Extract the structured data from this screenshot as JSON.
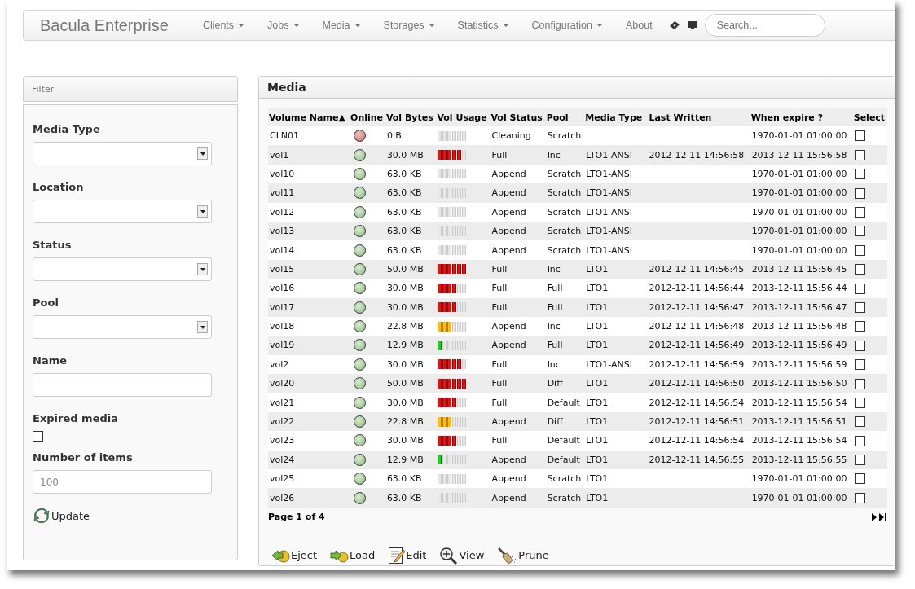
{
  "navbar": {
    "brand": "Bacula Enterprise",
    "menus": [
      {
        "label": "Clients",
        "dropdown": true
      },
      {
        "label": "Jobs",
        "dropdown": true
      },
      {
        "label": "Media",
        "dropdown": true
      },
      {
        "label": "Storages",
        "dropdown": true
      },
      {
        "label": "Statistics",
        "dropdown": true
      },
      {
        "label": "Configuration",
        "dropdown": true
      },
      {
        "label": "About",
        "dropdown": false
      }
    ],
    "search": {
      "placeholder": "Search..."
    }
  },
  "filter": {
    "title": "Filter",
    "fields": [
      {
        "kind": "select",
        "label": "Media Type"
      },
      {
        "kind": "select",
        "label": "Location"
      },
      {
        "kind": "select",
        "label": "Status"
      },
      {
        "kind": "select",
        "label": "Pool"
      },
      {
        "kind": "text",
        "label": "Name"
      },
      {
        "kind": "checkbox",
        "label": "Expired media",
        "checked": false
      },
      {
        "kind": "text",
        "label": "Number of items",
        "value": "100"
      }
    ],
    "update_button": "Update"
  },
  "media": {
    "title": "Media",
    "columns": [
      "Volume Name",
      "Online",
      "Vol Bytes",
      "Vol Usage",
      "Vol Status",
      "Pool",
      "Media Type",
      "Last Written",
      "When expire ?",
      "Select"
    ],
    "sort_marker": "▲",
    "rows": [
      {
        "name": "CLN01",
        "online": false,
        "bytes": "0 B",
        "level": 0,
        "status": "Cleaning",
        "pool": "Scratch",
        "media_type": "",
        "last_written": "",
        "expire": "1970-01-01 01:00:00",
        "selected": false
      },
      {
        "name": "vol1",
        "online": true,
        "bytes": "30.0 MB",
        "level": 0.83,
        "status": "Full",
        "pool": "Inc",
        "media_type": "LTO1-ANSI",
        "last_written": "2012-12-11 14:56:58",
        "expire": "2013-12-11 15:56:58",
        "selected": false
      },
      {
        "name": "vol10",
        "online": true,
        "bytes": "63.0 KB",
        "level": 0,
        "status": "Append",
        "pool": "Scratch",
        "media_type": "LTO1-ANSI",
        "last_written": "",
        "expire": "1970-01-01 01:00:00",
        "selected": false
      },
      {
        "name": "vol11",
        "online": true,
        "bytes": "63.0 KB",
        "level": 0,
        "status": "Append",
        "pool": "Scratch",
        "media_type": "LTO1-ANSI",
        "last_written": "",
        "expire": "1970-01-01 01:00:00",
        "selected": false
      },
      {
        "name": "vol12",
        "online": true,
        "bytes": "63.0 KB",
        "level": 0,
        "status": "Append",
        "pool": "Scratch",
        "media_type": "LTO1-ANSI",
        "last_written": "",
        "expire": "1970-01-01 01:00:00",
        "selected": false
      },
      {
        "name": "vol13",
        "online": true,
        "bytes": "63.0 KB",
        "level": 0,
        "status": "Append",
        "pool": "Scratch",
        "media_type": "LTO1-ANSI",
        "last_written": "",
        "expire": "1970-01-01 01:00:00",
        "selected": false
      },
      {
        "name": "vol14",
        "online": true,
        "bytes": "63.0 KB",
        "level": 0,
        "status": "Append",
        "pool": "Scratch",
        "media_type": "LTO1-ANSI",
        "last_written": "",
        "expire": "1970-01-01 01:00:00",
        "selected": false
      },
      {
        "name": "vol15",
        "online": true,
        "bytes": "50.0 MB",
        "level": 1,
        "status": "Full",
        "pool": "Inc",
        "media_type": "LTO1",
        "last_written": "2012-12-11 14:56:45",
        "expire": "2013-12-11 15:56:45",
        "selected": false
      },
      {
        "name": "vol16",
        "online": true,
        "bytes": "30.0 MB",
        "level": 0.67,
        "status": "Full",
        "pool": "Full",
        "media_type": "LTO1",
        "last_written": "2012-12-11 14:56:44",
        "expire": "2013-12-11 15:56:44",
        "selected": false
      },
      {
        "name": "vol17",
        "online": true,
        "bytes": "30.0 MB",
        "level": 0.67,
        "status": "Full",
        "pool": "Full",
        "media_type": "LTO1",
        "last_written": "2012-12-11 14:56:47",
        "expire": "2013-12-11 15:56:47",
        "selected": false
      },
      {
        "name": "vol18",
        "online": true,
        "bytes": "22.8 MB",
        "level": 0.5,
        "status": "Append",
        "pool": "Inc",
        "media_type": "LTO1",
        "last_written": "2012-12-11 14:56:48",
        "expire": "2013-12-11 15:56:48",
        "selected": false
      },
      {
        "name": "vol19",
        "online": true,
        "bytes": "12.9 MB",
        "level": 0.17,
        "status": "Append",
        "pool": "Full",
        "media_type": "LTO1",
        "last_written": "2012-12-11 14:56:49",
        "expire": "2013-12-11 15:56:49",
        "selected": false
      },
      {
        "name": "vol2",
        "online": true,
        "bytes": "30.0 MB",
        "level": 0.83,
        "status": "Full",
        "pool": "Inc",
        "media_type": "LTO1-ANSI",
        "last_written": "2012-12-11 14:56:59",
        "expire": "2013-12-11 15:56:59",
        "selected": false
      },
      {
        "name": "vol20",
        "online": true,
        "bytes": "50.0 MB",
        "level": 1,
        "status": "Full",
        "pool": "Diff",
        "media_type": "LTO1",
        "last_written": "2012-12-11 14:56:50",
        "expire": "2013-12-11 15:56:50",
        "selected": false
      },
      {
        "name": "vol21",
        "online": true,
        "bytes": "30.0 MB",
        "level": 0.67,
        "status": "Full",
        "pool": "Default",
        "media_type": "LTO1",
        "last_written": "2012-12-11 14:56:54",
        "expire": "2013-12-11 15:56:54",
        "selected": false
      },
      {
        "name": "vol22",
        "online": true,
        "bytes": "22.8 MB",
        "level": 0.5,
        "status": "Append",
        "pool": "Diff",
        "media_type": "LTO1",
        "last_written": "2012-12-11 14:56:51",
        "expire": "2013-12-11 15:56:51",
        "selected": false
      },
      {
        "name": "vol23",
        "online": true,
        "bytes": "30.0 MB",
        "level": 0.67,
        "status": "Full",
        "pool": "Default",
        "media_type": "LTO1",
        "last_written": "2012-12-11 14:56:54",
        "expire": "2013-12-11 15:56:54",
        "selected": false
      },
      {
        "name": "vol24",
        "online": true,
        "bytes": "12.9 MB",
        "level": 0.17,
        "status": "Append",
        "pool": "Default",
        "media_type": "LTO1",
        "last_written": "2012-12-11 14:56:55",
        "expire": "2013-12-11 15:56:55",
        "selected": false
      },
      {
        "name": "vol25",
        "online": true,
        "bytes": "63.0 KB",
        "level": 0,
        "status": "Append",
        "pool": "Scratch",
        "media_type": "LTO1",
        "last_written": "",
        "expire": "1970-01-01 01:00:00",
        "selected": false
      },
      {
        "name": "vol26",
        "online": true,
        "bytes": "63.0 KB",
        "level": 0,
        "status": "Append",
        "pool": "Scratch",
        "media_type": "LTO1",
        "last_written": "",
        "expire": "1970-01-01 01:00:00",
        "selected": false
      }
    ],
    "pager": "Page 1 of 4",
    "actions": [
      {
        "kind": "eject",
        "label": "Eject"
      },
      {
        "kind": "load",
        "label": "Load"
      },
      {
        "kind": "edit",
        "label": "Edit"
      },
      {
        "kind": "view",
        "label": "View"
      },
      {
        "kind": "prune",
        "label": "Prune"
      }
    ]
  }
}
